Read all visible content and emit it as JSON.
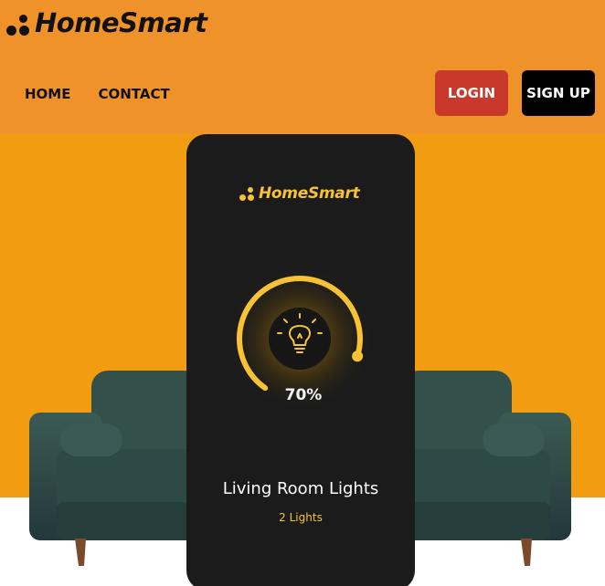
{
  "brand": {
    "name": "HomeSmart"
  },
  "nav": {
    "items": [
      "HOME",
      "CONTACT"
    ]
  },
  "auth": {
    "login_label": "LOGIN",
    "signup_label": "SIGN UP"
  },
  "device": {
    "brand": "HomeSmart",
    "percent_label": "70%",
    "level": 0.7,
    "name": "Living Room Lights",
    "count": "2 Lights"
  },
  "colors": {
    "header_bg": "#ef922a",
    "hero_bg": "#f29c12",
    "accent": "#f7c335",
    "login_bg": "#c8392b",
    "signup_bg": "#000000",
    "phone_bg": "#1b1b1b",
    "sofa": "#2f4a46"
  },
  "icons": [
    "logo-dots-icon",
    "lightbulb-icon"
  ]
}
